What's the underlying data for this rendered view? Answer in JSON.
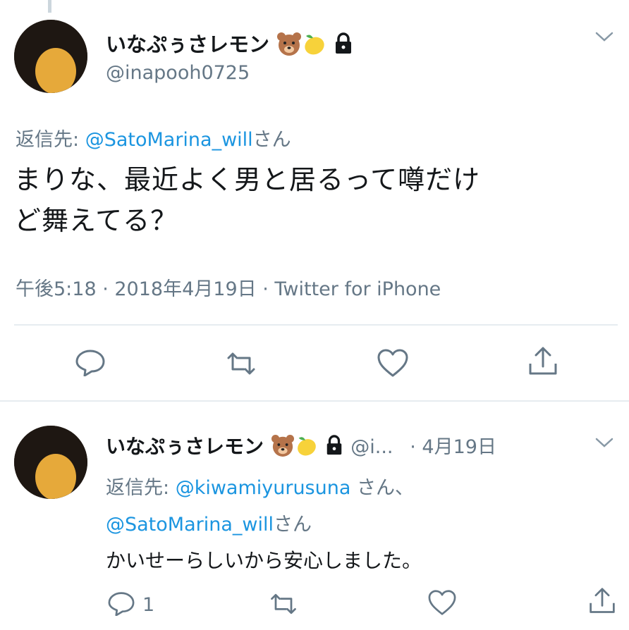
{
  "main_tweet": {
    "display_name": "いなぷぅさレモン",
    "handle": "@inapooh0725",
    "reply_prefix": "返信先: ",
    "reply_mention": "@SatoMarina_will",
    "reply_suffix": "さん",
    "text_line1": "まりな、最近よく男と居るって噂だけ",
    "text_line2": "ど舞えてる？",
    "meta": "午後5:18 · 2018年4月19日 · Twitter for iPhone"
  },
  "reply_tweet": {
    "display_name": "いなぷぅさレモン",
    "handle_truncated": "@i...",
    "date": "· 4月19日",
    "reply_prefix": "返信先: ",
    "reply_mention1": "@kiwamiyurusuna",
    "reply_mid": " さん、",
    "reply_mention2": "@SatoMarina_will",
    "reply_suffix": "さん",
    "text": "かいせーらしいから安心しました。",
    "reply_count": "1"
  },
  "icons": [
    "bear-icon",
    "lemon-icon",
    "lock-icon",
    "chevron-down-icon",
    "reply-icon",
    "retweet-icon",
    "like-icon",
    "share-icon"
  ],
  "colors": {
    "link": "#1b95e0",
    "secondary": "#657786",
    "text": "#14171a",
    "divider": "#e6ecf0"
  }
}
